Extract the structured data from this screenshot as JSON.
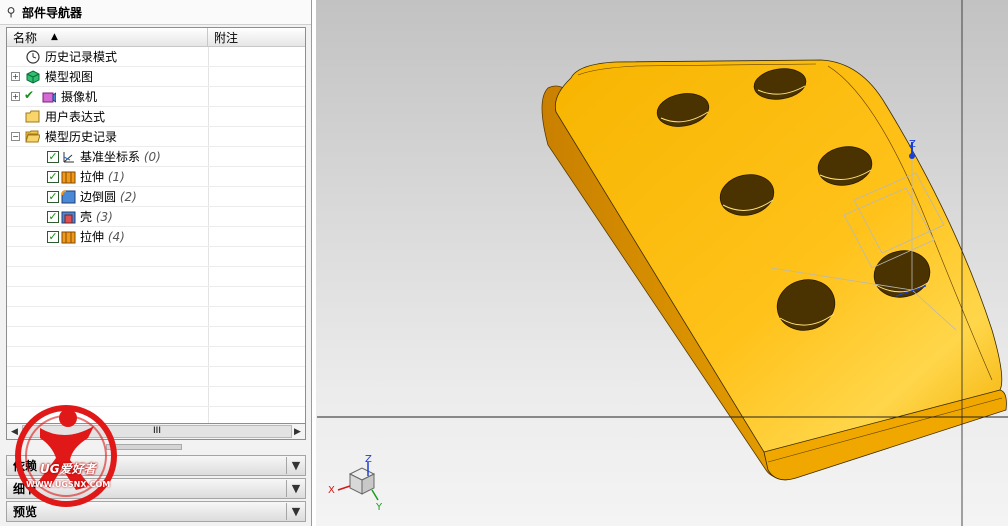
{
  "navigator": {
    "title": "部件导航器",
    "columns": {
      "name": "名称",
      "note": "附注"
    },
    "tree": [
      {
        "label": "历史记录模式",
        "count": "",
        "icon": "clock-icon"
      },
      {
        "label": "模型视图",
        "count": "",
        "icon": "model-view-icon"
      },
      {
        "label": "摄像机",
        "count": "",
        "icon": "camera-icon"
      },
      {
        "label": "用户表达式",
        "count": "",
        "icon": "folder-icon"
      },
      {
        "label": "模型历史记录",
        "count": "",
        "icon": "folder-open-icon"
      },
      {
        "label": "基准坐标系",
        "count": "(0)",
        "icon": "datum-csys-icon"
      },
      {
        "label": "拉伸",
        "count": "(1)",
        "icon": "extrude-icon"
      },
      {
        "label": "边倒圆",
        "count": "(2)",
        "icon": "edge-blend-icon"
      },
      {
        "label": "壳",
        "count": "(3)",
        "icon": "shell-icon"
      },
      {
        "label": "拉伸",
        "count": "(4)",
        "icon": "extrude-icon"
      }
    ],
    "scroll_thumb": "III",
    "panels": [
      {
        "title": "依赖"
      },
      {
        "title": "细节"
      },
      {
        "title": "预览"
      }
    ]
  },
  "viewport": {
    "csys_labels": {
      "x": "X",
      "y": "Y",
      "z": "Z"
    }
  },
  "watermark": {
    "brand": "UG爱好者",
    "url": "WWW.UGSNX.COM"
  },
  "colors": {
    "part": "#f7b500",
    "part_shadow": "#d98c00",
    "check": "#1a8f1a",
    "logo_red": "#e01818"
  }
}
